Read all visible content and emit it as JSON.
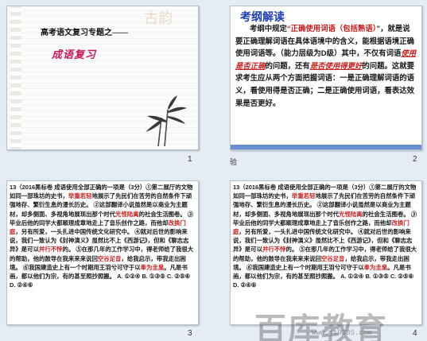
{
  "slides": [
    {
      "number": "1",
      "title": "高考语文复习专题之——",
      "subtitle": "成语复习",
      "seal_text": "古韵"
    },
    {
      "number": "2",
      "heading": "考纲解读",
      "body_parts": [
        {
          "t": "考纲中规定",
          "c": "plain"
        },
        {
          "t": "“正确使用词语（包括熟语）",
          "c": "red"
        },
        {
          "t": "”，就是说要正确理解词语在具体语境中的含义，能根据语境正确使用词语等。（能力层级为D级）其中，不仅有词语",
          "c": "plain"
        },
        {
          "t": "使用是否正确",
          "c": "it"
        },
        {
          "t": "的问题，还有",
          "c": "plain"
        },
        {
          "t": "是否使用得更好",
          "c": "it"
        },
        {
          "t": "的问题。这就要求考生应从两个方面把握词语：一是正确理解词语的语义，看使用得是否正确；二是正确使用词语，看表达效果是否更好。",
          "c": "plain"
        }
      ]
    },
    {
      "number": "3",
      "question_parts": [
        {
          "t": "13（2016黑标卷 成语使用全部正确的一项是（3分）",
          "c": "plain"
        },
        {
          "t": "①第二展厅的文物如同一部珠坊的史书，",
          "c": "plain"
        },
        {
          "t": "举重若轻",
          "c": "red"
        },
        {
          "t": "地展示了先民们在苦劳的自然条件下顽强地存、繁衍生息的漫长历史。 ②这部翻译小说虽然是以商业为主题材，却多侧面、多视角地展现出那个时代",
          "c": "plain"
        },
        {
          "t": "光怪陆离",
          "c": "red"
        },
        {
          "t": "的社会生活图卷。 ③毕业后他的同学大都顺理成章地走上了音乐创作之路，而他却",
          "c": "plain"
        },
        {
          "t": "改换门庭",
          "c": "red"
        },
        {
          "t": "，另有所爱，一头扎进中国传统文化研究中。 ④就对后世的影响来说，我们一致认为《封神演义》虽然比不上《西游记》，但和《聊志志异》是可以",
          "c": "plain"
        },
        {
          "t": "并行不悖",
          "c": "red"
        },
        {
          "t": "的。 ⑤在那几年的工作学习中，得老师给了我很大的帮助，他的鼓导在我来来来说回",
          "c": "plain"
        },
        {
          "t": "空谷足音",
          "c": "red"
        },
        {
          "t": "，给我启示，带我走出困境。 ⑥我国建造史上有一个时期用王羽兮可守于以",
          "c": "plain"
        },
        {
          "t": "奉为圭臬",
          "c": "red"
        },
        {
          "t": "。凡是书画，都以他们为宗，有的甚至照抄照搬。 A. ①②④ B. ①③⑤ C. ②⑤⑥ D. ②④⑥",
          "c": "plain"
        }
      ]
    },
    {
      "number": "4",
      "question_parts": [
        {
          "t": "13（2016黑标卷 成语使用全部正确的一项是（3分）",
          "c": "plain"
        },
        {
          "t": "①第二展厅的文物如同一部珠坊的史书，",
          "c": "plain"
        },
        {
          "t": "举重若轻",
          "c": "red"
        },
        {
          "t": "地展示了先民们在苦劳的自然条件下顽强地存、繁衍生息的漫长历史。 ②这部翻译小说虽然是以商业为主题材，却多侧面、多视角地展现出那个时代",
          "c": "plain"
        },
        {
          "t": "光怪陆离",
          "c": "red"
        },
        {
          "t": "的社会生活图卷。 ③毕业后他的同学大都顺理成章地走上了音乐创作之路，而他却",
          "c": "plain"
        },
        {
          "t": "改换门庭",
          "c": "red"
        },
        {
          "t": "，另有所爱，一头扎进中国传统文化研究中。 ④就对后世的影响来说，我们一致认为《封神演义》虽然比不上《西游记》，但和《聊志志异》是可以",
          "c": "plain"
        },
        {
          "t": "并行不悖",
          "c": "red"
        },
        {
          "t": "的。 ⑤在那几年的工作学习中，得老师给了我很大的帮助，他的鼓导在我来来来说回",
          "c": "plain"
        },
        {
          "t": "空谷足音",
          "c": "red"
        },
        {
          "t": "，给我启示，带我走出困境。 ⑥我国建造史上有一个时期用王羽兮可守于以",
          "c": "plain"
        },
        {
          "t": "奉为圭臬",
          "c": "red"
        },
        {
          "t": "。凡是书画，都以他们为宗，有的甚至照抄照搬。 A. ①②④ B. ①③⑤ C. ②⑤⑥ D. ②④⑥",
          "c": "plain"
        }
      ]
    }
  ],
  "stray_glyph": "验",
  "watermark": {
    "text": "百库教育",
    "url": "www.jt0335.com"
  }
}
